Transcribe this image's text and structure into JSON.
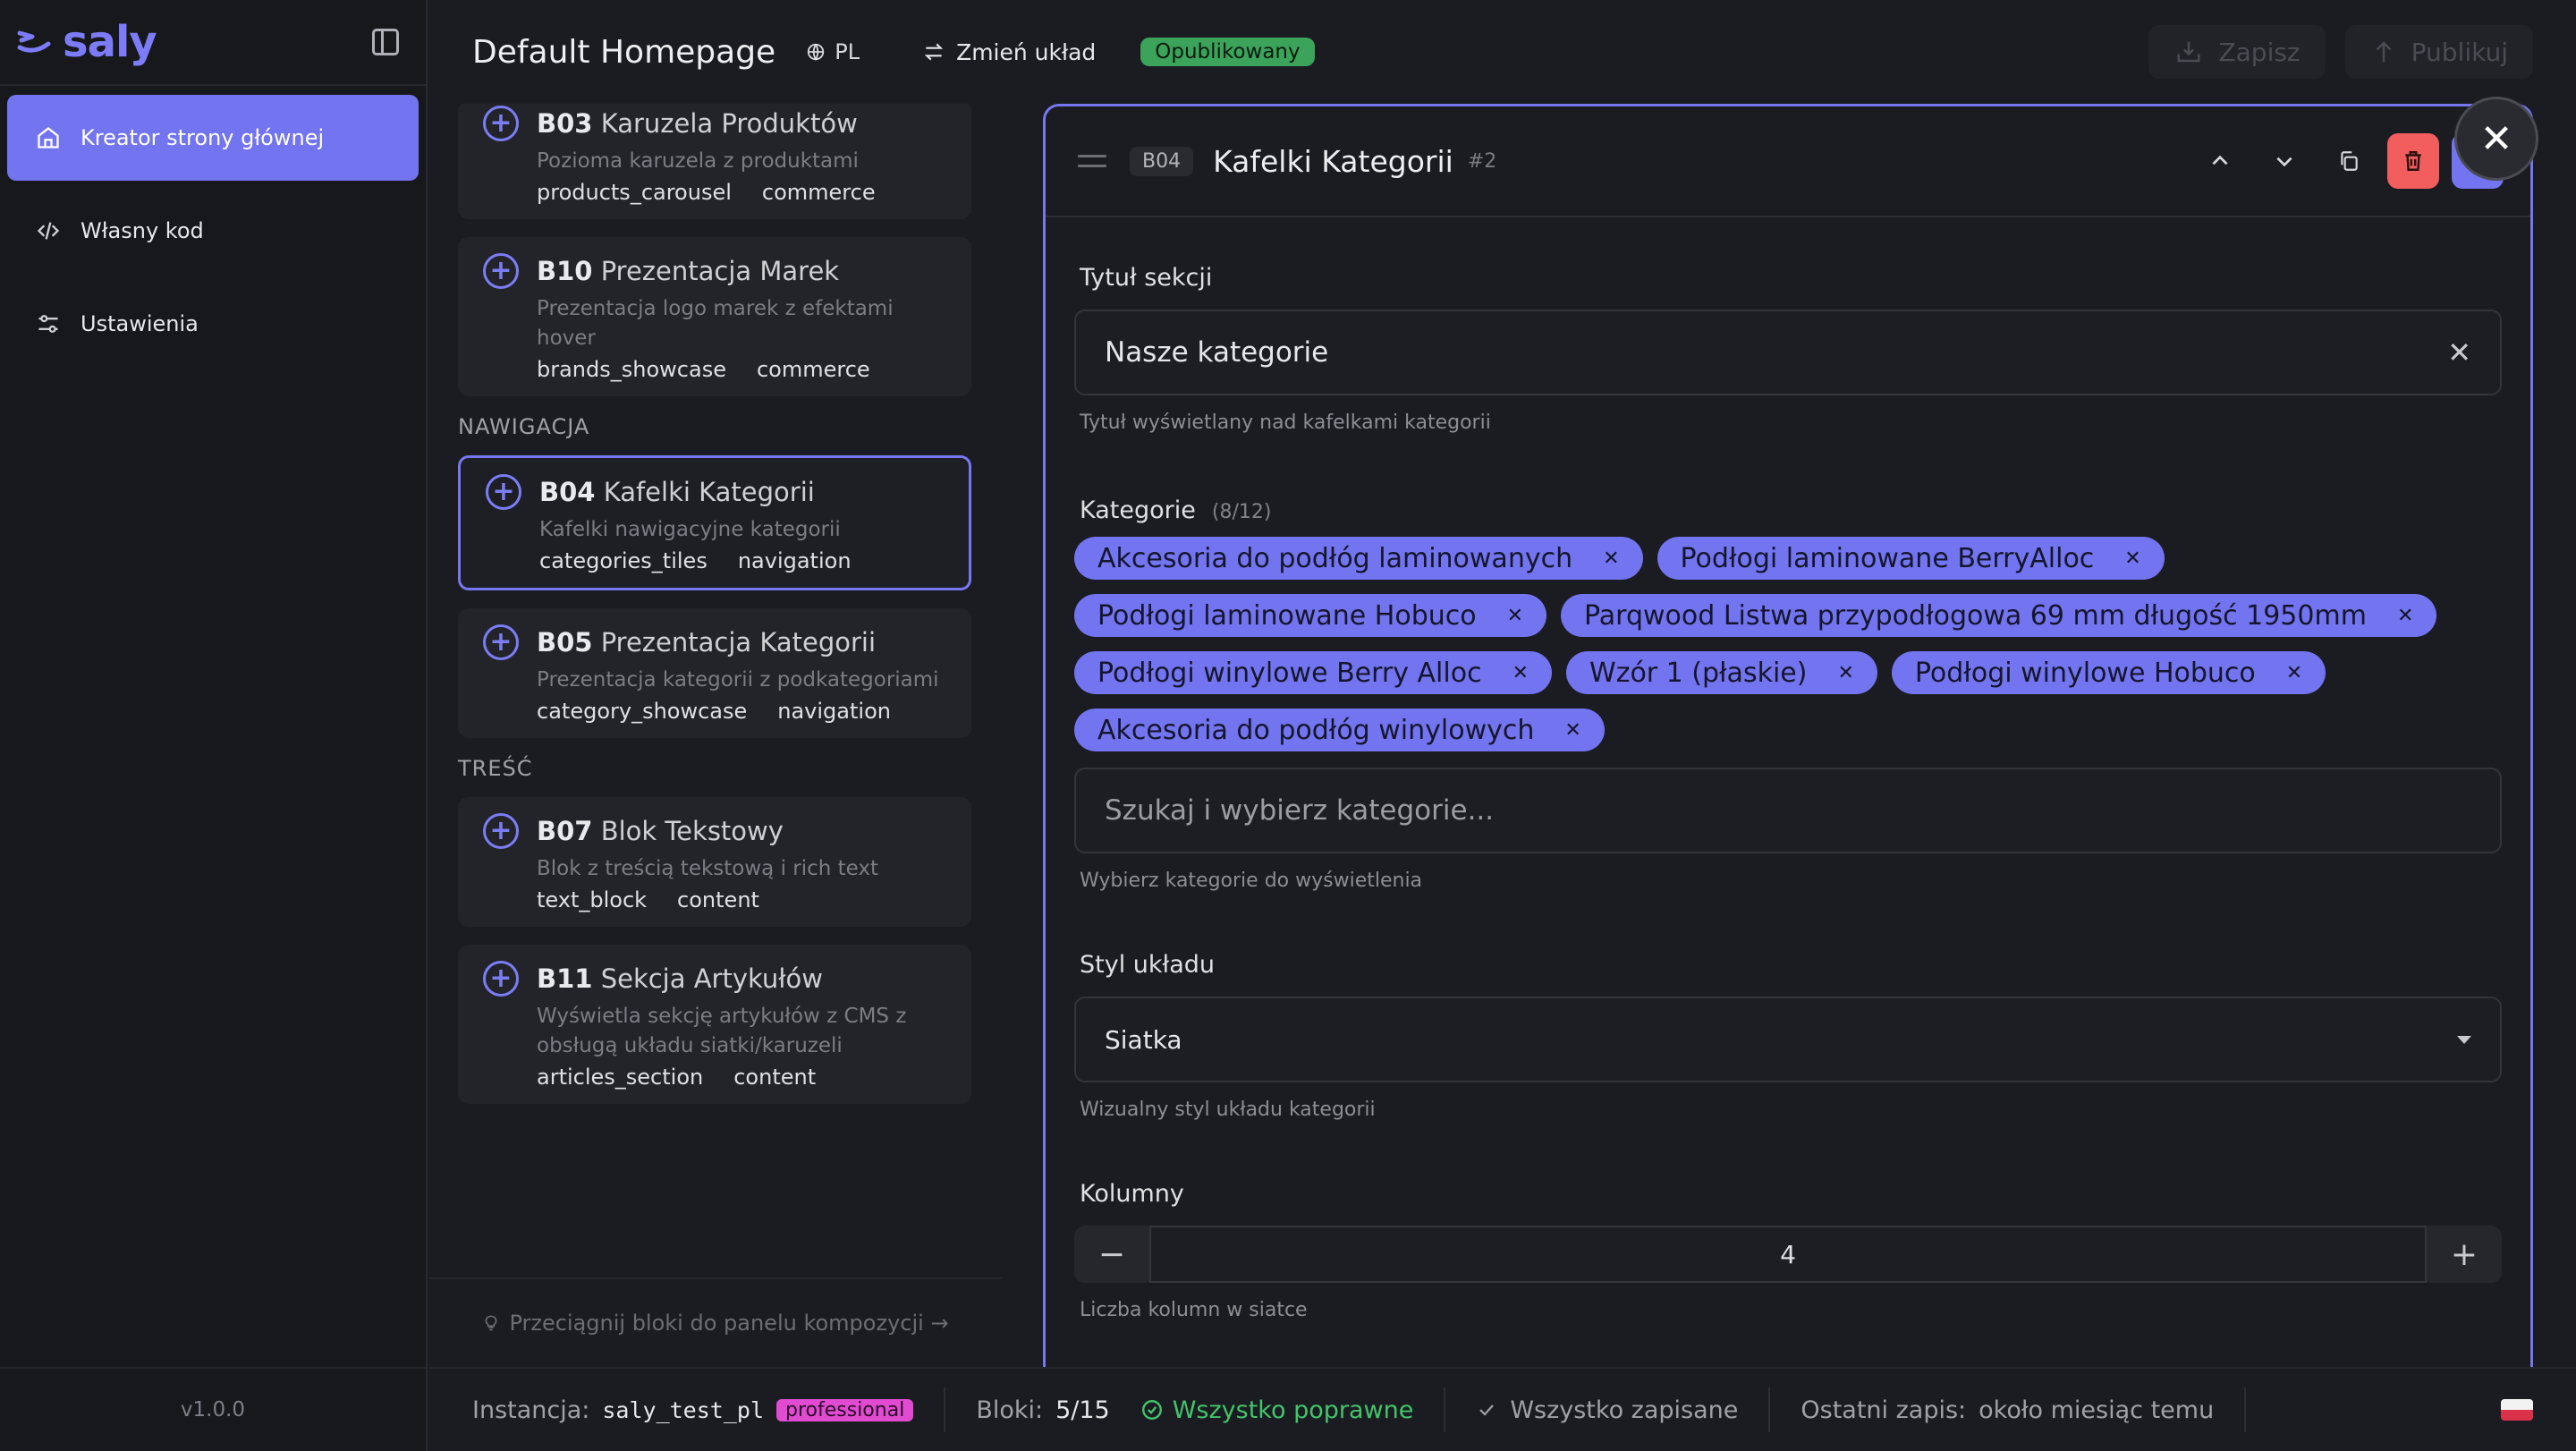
{
  "app": {
    "logo": "saly",
    "version": "v1.0.0"
  },
  "sidebar": {
    "items": [
      {
        "label": "Kreator strony głównej",
        "icon": "home-icon",
        "active": true
      },
      {
        "label": "Własny kod",
        "icon": "code-icon",
        "active": false
      },
      {
        "label": "Ustawienia",
        "icon": "sliders-icon",
        "active": false
      }
    ]
  },
  "header": {
    "title": "Default Homepage",
    "language": "PL",
    "change_layout": "Zmień układ",
    "status": "Opublikowany",
    "save": "Zapisz",
    "publish": "Publikuj"
  },
  "blocks": {
    "items": [
      {
        "code": "B03",
        "name": "Karuzela Produktów",
        "desc": "Pozioma karuzela z produktami",
        "tags": [
          "products_carousel",
          "commerce"
        ]
      },
      {
        "code": "B10",
        "name": "Prezentacja Marek",
        "desc": "Prezentacja logo marek z efektami hover",
        "tags": [
          "brands_showcase",
          "commerce"
        ]
      }
    ],
    "group_nav": "NAWIGACJA",
    "nav_items": [
      {
        "code": "B04",
        "name": "Kafelki Kategorii",
        "desc": "Kafelki nawigacyjne kategorii",
        "tags": [
          "categories_tiles",
          "navigation"
        ]
      },
      {
        "code": "B05",
        "name": "Prezentacja Kategorii",
        "desc": "Prezentacja kategorii z podkategoriami",
        "tags": [
          "category_showcase",
          "navigation"
        ]
      }
    ],
    "group_content": "TREŚĆ",
    "content_items": [
      {
        "code": "B07",
        "name": "Blok Tekstowy",
        "desc": "Blok z treścią tekstową i rich text",
        "tags": [
          "text_block",
          "content"
        ]
      },
      {
        "code": "B11",
        "name": "Sekcja Artykułów",
        "desc": "Wyświetla sekcję artykułów z CMS z obsługą układu siatki/karuzeli",
        "tags": [
          "articles_section",
          "content"
        ]
      }
    ],
    "drag_hint": "Przeciągnij bloki do panelu kompozycji →"
  },
  "editor": {
    "code": "B04",
    "title": "Kafelki Kategorii",
    "index": "#2",
    "section_title": {
      "label": "Tytuł sekcji",
      "value": "Nasze kategorie",
      "help": "Tytuł wyświetlany nad kafelkami kategorii"
    },
    "categories": {
      "label": "Kategorie",
      "count": "(8/12)",
      "chips": [
        "Akcesoria do podłóg laminowanych",
        "Podłogi laminowane BerryAlloc",
        "Podłogi laminowane Hobuco",
        "Parqwood Listwa przypodłogowa 69 mm długość 1950mm",
        "Podłogi winylowe Berry Alloc",
        "Wzór 1 (płaskie)",
        "Podłogi winylowe Hobuco",
        "Akcesoria do podłóg winylowych"
      ],
      "placeholder": "Szukaj i wybierz kategorie...",
      "help": "Wybierz kategorie do wyświetlenia"
    },
    "layout_style": {
      "label": "Styl układu",
      "value": "Siatka",
      "help": "Wizualny styl układu kategorii"
    },
    "columns": {
      "label": "Kolumny",
      "value": "4",
      "help": "Liczba kolumn w siatce"
    }
  },
  "status": {
    "instance_label": "Instancja:",
    "instance": "saly_test_pl",
    "plan": "professional",
    "blocks_label": "Bloki:",
    "blocks": "5/15",
    "valid": "Wszystko poprawne",
    "saved": "Wszystko zapisane",
    "last_save_label": "Ostatni zapis:",
    "last_save": "około miesiąc temu"
  },
  "colors": {
    "accent": "#7274f0",
    "success": "#3ba35a",
    "danger": "#f25d5d",
    "plan": "#e04bd2"
  }
}
